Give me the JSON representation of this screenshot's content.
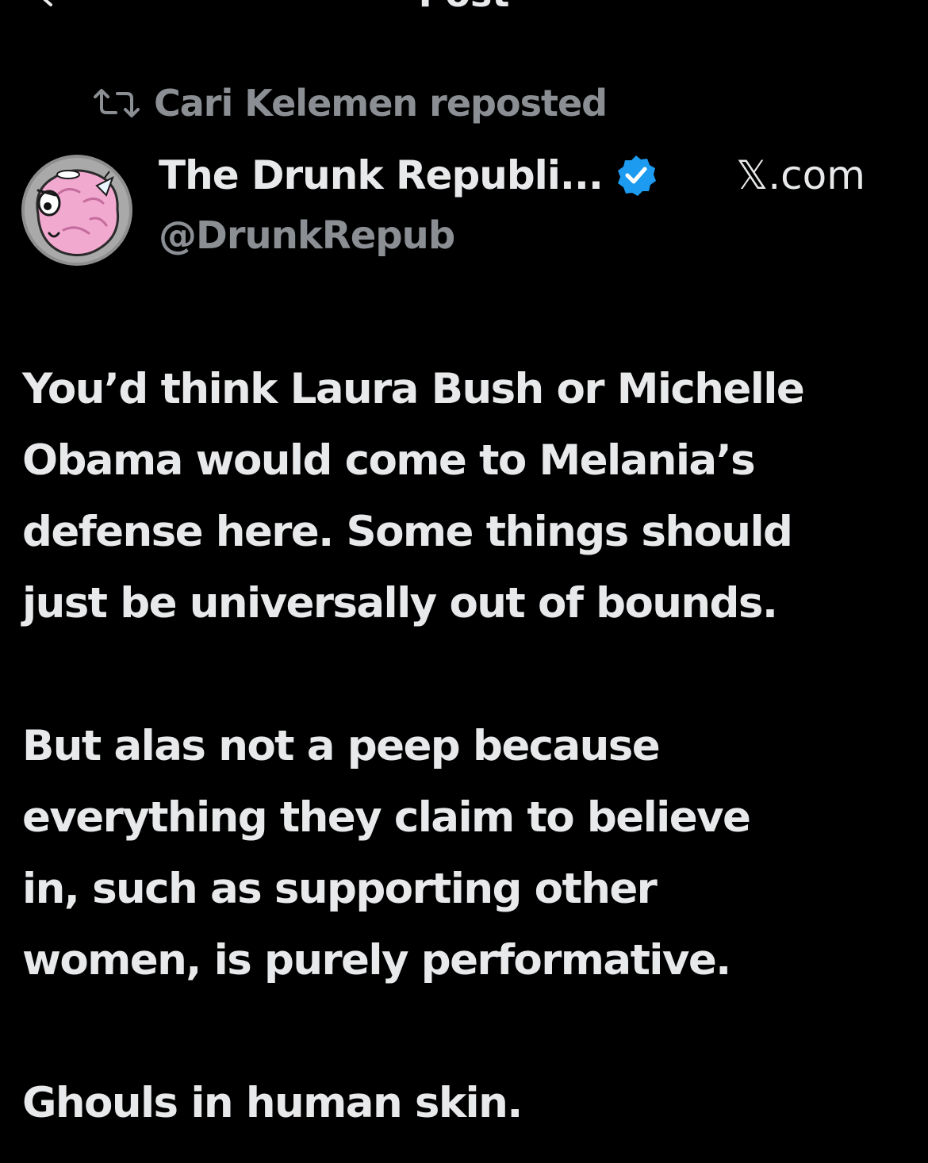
{
  "header": {
    "title": "Post"
  },
  "repost": {
    "label": "Cari Kelemen reposted",
    "icon": "repost-icon"
  },
  "author": {
    "display_name": "The Drunk Republi...",
    "handle": "@DrunkRepub",
    "verified": true,
    "verified_color": "#1d9bf0",
    "avatar_icon": "pink-brain-cartoon-avatar"
  },
  "source": {
    "label": "𝕏.com"
  },
  "post": {
    "paragraphs": [
      "You’d think Laura Bush or Michelle\nObama would come to Melania’s\ndefense here. Some things should\njust be universally out of bounds.",
      "But alas not a peep because\neverything they claim to believe\nin, such as supporting other\nwomen, is purely performative.",
      "Ghouls in human skin."
    ]
  },
  "colors": {
    "background": "#000000",
    "primary_text": "#e7e9ea",
    "secondary_text": "#8b8f94"
  }
}
